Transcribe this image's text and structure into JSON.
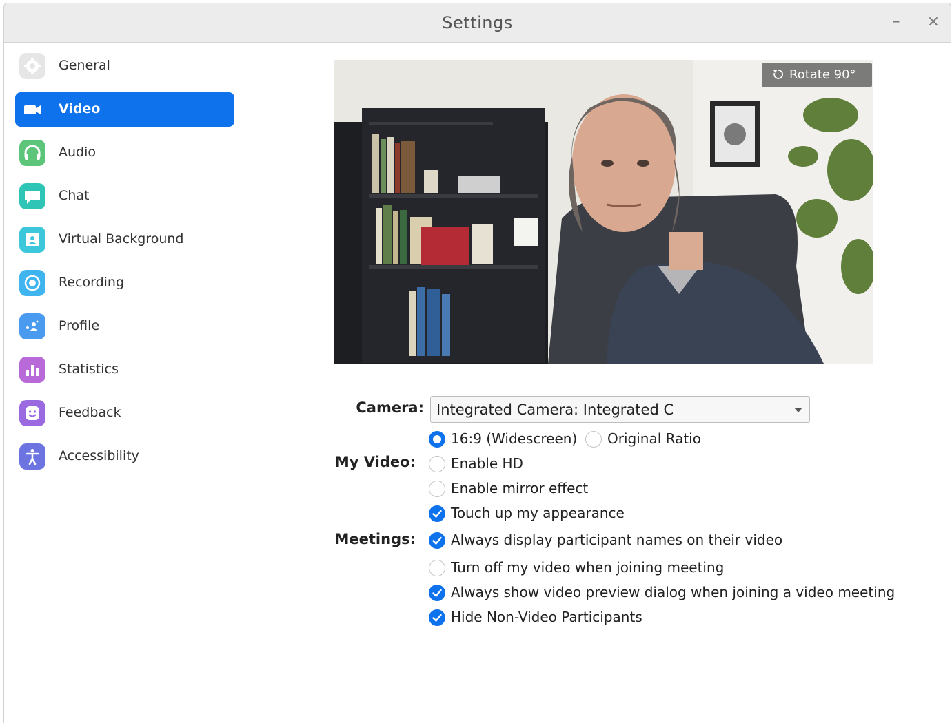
{
  "window": {
    "title": "Settings",
    "minimize_glyph": "–",
    "close_glyph": "×"
  },
  "sidebar": {
    "items": [
      {
        "label": "General",
        "icon": "gear-icon",
        "color": "#e6e6e6"
      },
      {
        "label": "Video",
        "icon": "video-camera-icon",
        "color": "#0e72ed",
        "active": true
      },
      {
        "label": "Audio",
        "icon": "headphones-icon",
        "color": "#5cc57a"
      },
      {
        "label": "Chat",
        "icon": "chat-bubble-icon",
        "color": "#2ec4b6"
      },
      {
        "label": "Virtual Background",
        "icon": "person-portrait-icon",
        "color": "#3cc7da"
      },
      {
        "label": "Recording",
        "icon": "record-icon",
        "color": "#3fb4ee"
      },
      {
        "label": "Profile",
        "icon": "profile-icon",
        "color": "#4a9bf0"
      },
      {
        "label": "Statistics",
        "icon": "bar-chart-icon",
        "color": "#b86ad8"
      },
      {
        "label": "Feedback",
        "icon": "smiley-icon",
        "color": "#9b6ae0"
      },
      {
        "label": "Accessibility",
        "icon": "accessibility-icon",
        "color": "#6b74e0"
      }
    ]
  },
  "preview": {
    "rotate_label": "Rotate 90°"
  },
  "camera": {
    "label": "Camera:",
    "selected": "Integrated Camera: Integrated C"
  },
  "my_video": {
    "label": "My Video:",
    "aspect": [
      {
        "label": "16:9 (Widescreen)",
        "selected": true
      },
      {
        "label": "Original Ratio",
        "selected": false
      }
    ],
    "options": [
      {
        "label": "Enable HD",
        "checked": false
      },
      {
        "label": "Enable mirror effect",
        "checked": false
      },
      {
        "label": "Touch up my appearance",
        "checked": true
      }
    ]
  },
  "meetings": {
    "label": "Meetings:",
    "options": [
      {
        "label": "Always display participant names on their video",
        "checked": true
      },
      {
        "label": "Turn off my video when joining meeting",
        "checked": false
      },
      {
        "label": "Always show video preview dialog when joining a video meeting",
        "checked": true
      },
      {
        "label": "Hide Non-Video Participants",
        "checked": true
      }
    ]
  },
  "colors": {
    "accent": "#0e72ed"
  }
}
